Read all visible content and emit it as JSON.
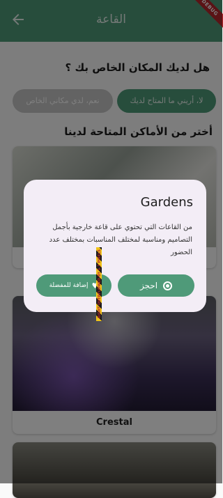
{
  "appbar": {
    "title": "القاعة",
    "debug_banner": "DEBUG"
  },
  "question": "هل لديك المكان الخاص بك ؟",
  "options": {
    "no_label": "لا، أريني ما المتاح لديك",
    "yes_label": "نعم، لدي مكاني الخاص"
  },
  "choose_heading": "أختر من الأماكن المتاحة لدينا",
  "venues": [
    {
      "name": ""
    },
    {
      "name": "Crestal"
    },
    {
      "name": ""
    }
  ],
  "dialog": {
    "title": "Gardens",
    "body": "من القاعات التي تحتوي على قاعة خارجية بأجمل التصاميم ومناسبة لمختلف المناسبات بمختلف عدد الحضور",
    "book_label": "احجز",
    "favorite_label": "إضافة للمفضلة"
  },
  "overflow_warning": "RIGHT OVERFLOWED BY 5.7 PIXELS",
  "colors": {
    "primary": "#4f9a79",
    "chip_disabled": "#c7c7c7",
    "dialog_bg": "#f3edf6",
    "debug_red": "#b4272d"
  }
}
